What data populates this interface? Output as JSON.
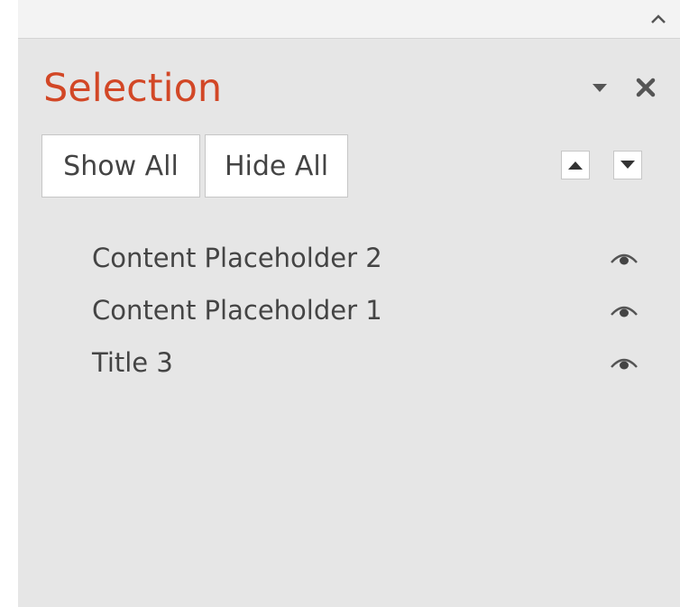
{
  "pane": {
    "title": "Selection",
    "show_all_label": "Show All",
    "hide_all_label": "Hide All",
    "items": [
      {
        "label": "Content Placeholder 2",
        "visibility_icon": "eye-icon"
      },
      {
        "label": "Content Placeholder 1",
        "visibility_icon": "eye-icon"
      },
      {
        "label": "Title 3",
        "visibility_icon": "eye-icon"
      }
    ]
  },
  "icons": {
    "collapse_ribbon": "chevron-up-icon",
    "pane_options": "caret-down-icon",
    "close": "close-icon",
    "bring_forward": "triangle-up-icon",
    "send_backward": "triangle-down-icon"
  },
  "colors": {
    "title": "#d24726",
    "pane_bg": "#e6e6e6",
    "text": "#444444",
    "icon": "#555555"
  }
}
